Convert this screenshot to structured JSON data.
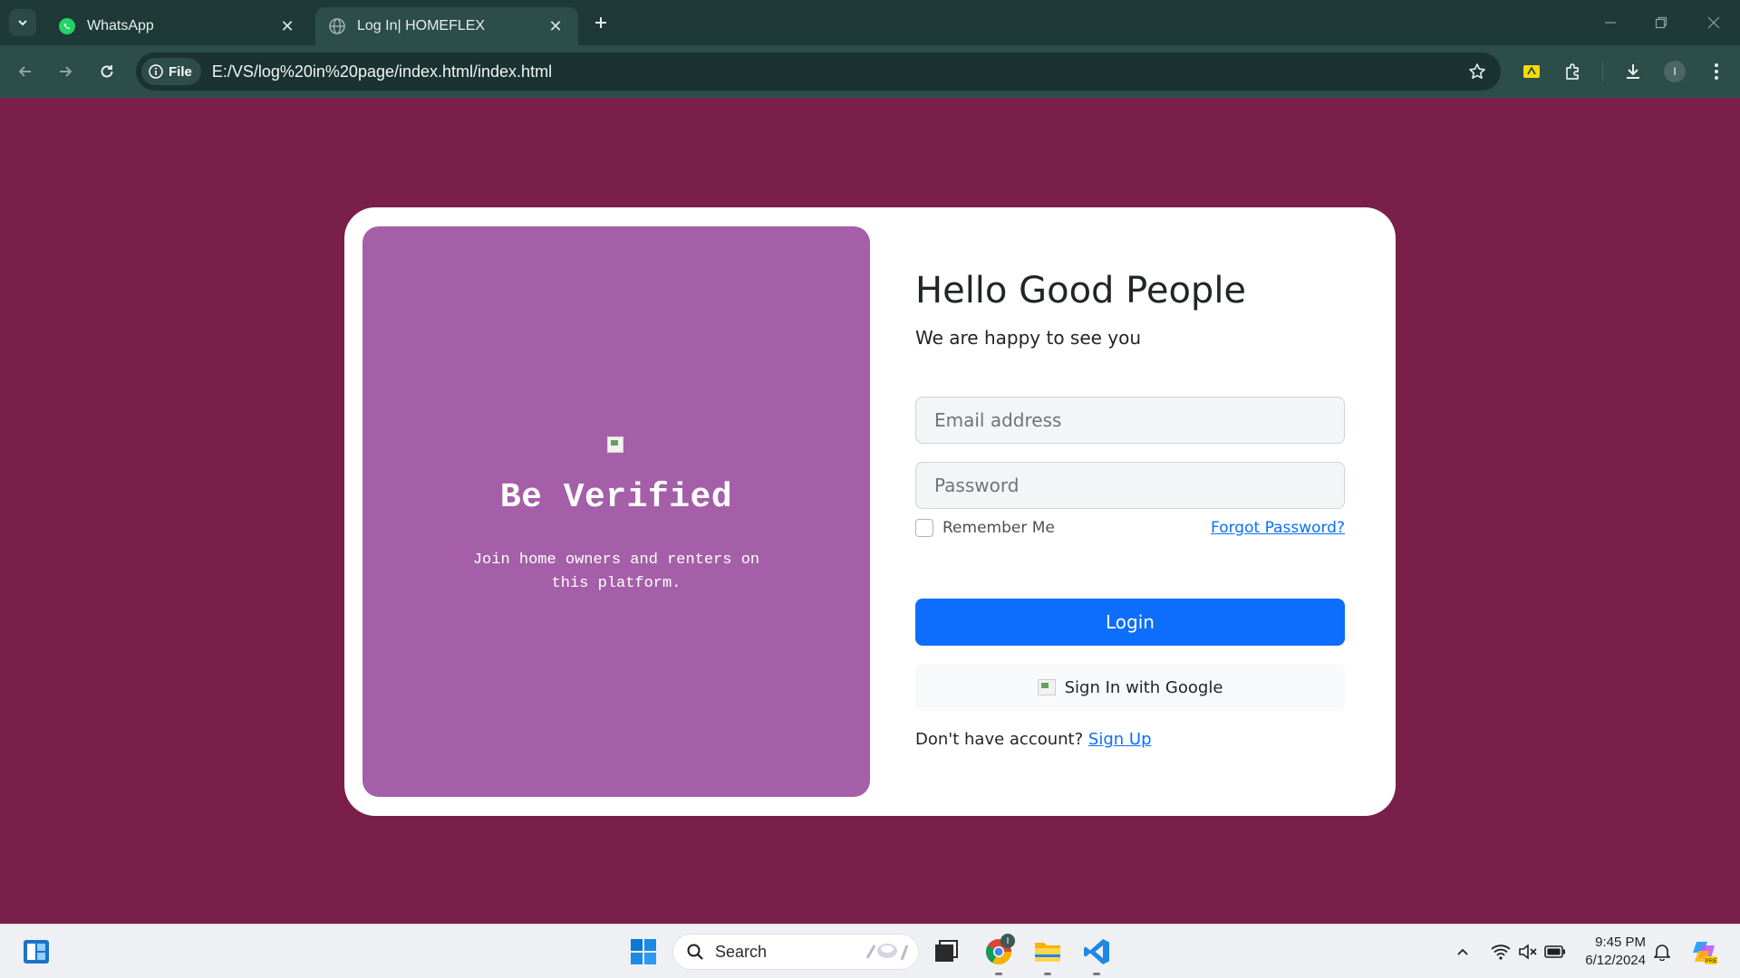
{
  "browser": {
    "tabs": [
      {
        "title": "WhatsApp",
        "favicon": "whatsapp-icon",
        "active": false
      },
      {
        "title": "Log In| HOMEFLEX",
        "favicon": "globe-icon",
        "active": true
      }
    ],
    "site_chip": "File",
    "url": "E:/VS/log%20in%20page/index.html/index.html",
    "profile_initial": "I",
    "theme_color": "#2c4d48"
  },
  "page": {
    "background": "#7a1e4a",
    "hero": {
      "title": "Be Verified",
      "subtitle": "Join home owners and renters on this platform.",
      "color": "#a55fa8"
    },
    "form": {
      "heading": "Hello Good People",
      "subheading": "We are happy to see you",
      "email_placeholder": "Email address",
      "password_placeholder": "Password",
      "remember_label": "Remember Me",
      "forgot_label": "Forgot Password?",
      "login_label": "Login",
      "google_label": "Sign In with Google",
      "no_account_text": "Don't have account?",
      "signup_label": "Sign Up",
      "accent": "#0d6efd"
    }
  },
  "taskbar": {
    "search_label": "Search",
    "time": "9:45 PM",
    "date": "6/12/2024",
    "chrome_badge": "I"
  }
}
